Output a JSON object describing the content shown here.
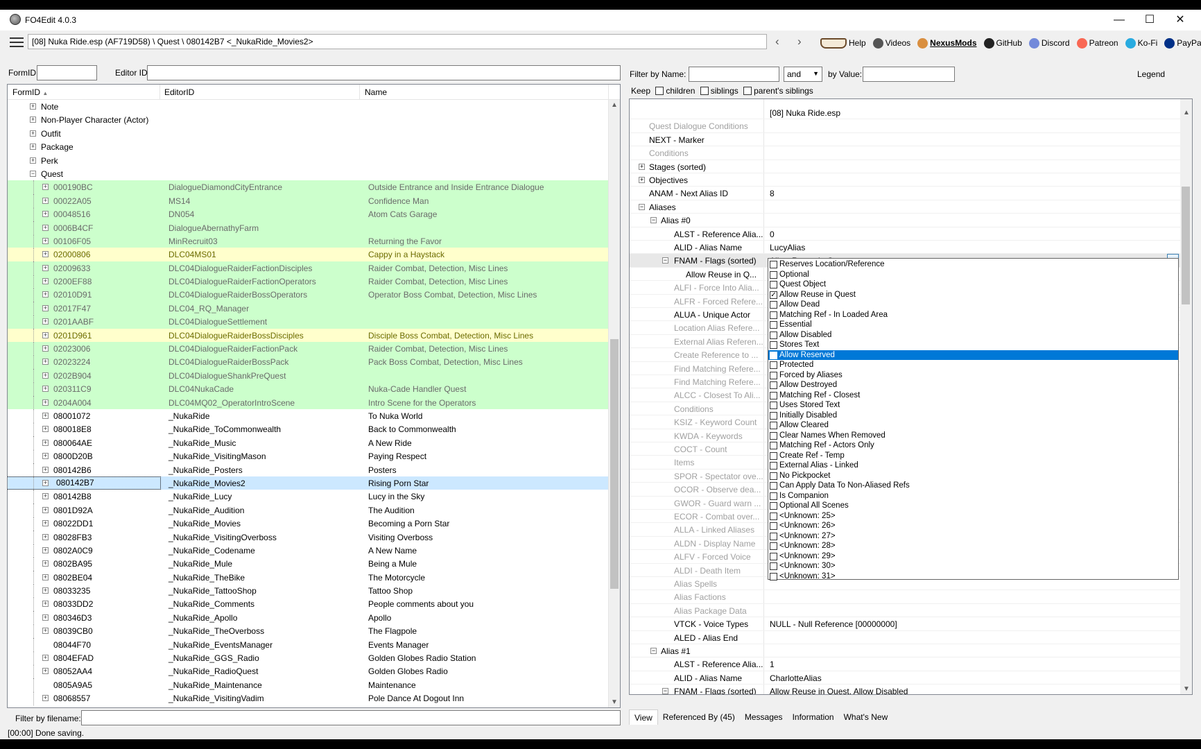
{
  "window": {
    "title": "FO4Edit 4.0.3",
    "controls": {
      "minimize": "—",
      "maximize": "☐",
      "close": "✕"
    }
  },
  "toolbar": {
    "path": "[08] Nuka Ride.esp (AF719D58) \\ Quest \\ 080142B7 <_NukaRide_Movies2>",
    "back": "‹",
    "forward": "›",
    "links": [
      {
        "label": "Help",
        "icon": "book-icon"
      },
      {
        "label": "Videos",
        "icon": "video-icon"
      },
      {
        "label": "NexusMods",
        "icon": "nexus-icon"
      },
      {
        "label": "GitHub",
        "icon": "github-icon"
      },
      {
        "label": "Discord",
        "icon": "discord-icon"
      },
      {
        "label": "Patreon",
        "icon": "patreon-icon"
      },
      {
        "label": "Ko-Fi",
        "icon": "kofi-icon"
      },
      {
        "label": "PayPal",
        "icon": "paypal-icon"
      }
    ]
  },
  "left": {
    "formid_label": "FormID",
    "editorid_label": "Editor ID",
    "formid_value": "",
    "editorid_value": "",
    "columns": {
      "formid": "FormID",
      "sort": "▲",
      "editorid": "EditorID",
      "name": "Name"
    },
    "tree": [
      {
        "id": "Note",
        "eid": "",
        "name": "",
        "type": "group"
      },
      {
        "id": "Non-Player Character (Actor)",
        "eid": "",
        "name": "",
        "type": "group"
      },
      {
        "id": "Outfit",
        "eid": "",
        "name": "",
        "type": "group"
      },
      {
        "id": "Package",
        "eid": "",
        "name": "",
        "type": "group"
      },
      {
        "id": "Perk",
        "eid": "",
        "name": "",
        "type": "group"
      },
      {
        "id": "Quest",
        "eid": "",
        "name": "",
        "type": "open"
      },
      {
        "id": "000190BC",
        "eid": "DialogueDiamondCityEntrance",
        "name": "Outside Entrance and Inside Entrance Dialogue",
        "type": "green"
      },
      {
        "id": "00022A05",
        "eid": "MS14",
        "name": "Confidence Man",
        "type": "green"
      },
      {
        "id": "00048516",
        "eid": "DN054",
        "name": "Atom Cats Garage",
        "type": "green"
      },
      {
        "id": "0006B4CF",
        "eid": "DialogueAbernathyFarm",
        "name": "",
        "type": "green"
      },
      {
        "id": "00106F05",
        "eid": "MinRecruit03",
        "name": "Returning the Favor",
        "type": "green"
      },
      {
        "id": "02000806",
        "eid": "DLC04MS01",
        "name": "Cappy in a Haystack",
        "type": "yellow"
      },
      {
        "id": "02009633",
        "eid": "DLC04DialogueRaiderFactionDisciples",
        "name": "Raider Combat, Detection, Misc Lines",
        "type": "green"
      },
      {
        "id": "0200EF88",
        "eid": "DLC04DialogueRaiderFactionOperators",
        "name": "Raider Combat, Detection, Misc Lines",
        "type": "green"
      },
      {
        "id": "02010D91",
        "eid": "DLC04DialogueRaiderBossOperators",
        "name": "Operator Boss Combat, Detection, Misc Lines",
        "type": "green"
      },
      {
        "id": "02017F47",
        "eid": "DLC04_RQ_Manager",
        "name": "",
        "type": "green"
      },
      {
        "id": "0201AABF",
        "eid": "DLC04DialogueSettlement",
        "name": "",
        "type": "green"
      },
      {
        "id": "0201D961",
        "eid": "DLC04DialogueRaiderBossDisciples",
        "name": "Disciple Boss Combat, Detection, Misc Lines",
        "type": "yellow"
      },
      {
        "id": "02023006",
        "eid": "DLC04DialogueRaiderFactionPack",
        "name": "Raider Combat, Detection, Misc Lines",
        "type": "green"
      },
      {
        "id": "02023224",
        "eid": "DLC04DialogueRaiderBossPack",
        "name": "Pack Boss Combat, Detection, Misc Lines",
        "type": "green"
      },
      {
        "id": "0202B904",
        "eid": "DLC04DialogueShankPreQuest",
        "name": "",
        "type": "green"
      },
      {
        "id": "020311C9",
        "eid": "DLC04NukaCade",
        "name": "Nuka-Cade Handler Quest",
        "type": "green"
      },
      {
        "id": "0204A004",
        "eid": "DLC04MQ02_OperatorIntroScene",
        "name": "Intro Scene for the Operators",
        "type": "green"
      },
      {
        "id": "08001072",
        "eid": "_NukaRide",
        "name": "To Nuka World",
        "type": "normal"
      },
      {
        "id": "080018E8",
        "eid": "_NukaRide_ToCommonwealth",
        "name": "Back to Commonwealth",
        "type": "normal"
      },
      {
        "id": "080064AE",
        "eid": "_NukaRide_Music",
        "name": "A New Ride",
        "type": "normal"
      },
      {
        "id": "0800D20B",
        "eid": "_NukaRide_VisitingMason",
        "name": "Paying Respect",
        "type": "normal"
      },
      {
        "id": "080142B6",
        "eid": "_NukaRide_Posters",
        "name": "Posters",
        "type": "normal"
      },
      {
        "id": "080142B7",
        "eid": "_NukaRide_Movies2",
        "name": "Rising Porn Star",
        "type": "sel"
      },
      {
        "id": "080142B8",
        "eid": "_NukaRide_Lucy",
        "name": "Lucy in the Sky",
        "type": "normal"
      },
      {
        "id": "0801D92A",
        "eid": "_NukaRide_Audition",
        "name": "The Audition",
        "type": "normal"
      },
      {
        "id": "08022DD1",
        "eid": "_NukaRide_Movies",
        "name": "Becoming a Porn Star",
        "type": "normal"
      },
      {
        "id": "08028FB3",
        "eid": "_NukaRide_VisitingOverboss",
        "name": "Visiting Overboss",
        "type": "normal"
      },
      {
        "id": "0802A0C9",
        "eid": "_NukaRide_Codename",
        "name": "A New Name",
        "type": "normal"
      },
      {
        "id": "0802BA95",
        "eid": "_NukaRide_Mule",
        "name": "Being a Mule",
        "type": "normal"
      },
      {
        "id": "0802BE04",
        "eid": "_NukaRide_TheBike",
        "name": "The Motorcycle",
        "type": "normal"
      },
      {
        "id": "08033235",
        "eid": "_NukaRide_TattooShop",
        "name": "Tattoo Shop",
        "type": "normal"
      },
      {
        "id": "08033DD2",
        "eid": "_NukaRide_Comments",
        "name": "People comments about you",
        "type": "normal"
      },
      {
        "id": "080346D3",
        "eid": "_NukaRide_Apollo",
        "name": "Apollo",
        "type": "normal"
      },
      {
        "id": "08039CB0",
        "eid": "_NukaRide_TheOverboss",
        "name": "The Flagpole",
        "type": "normal"
      },
      {
        "id": "08044F70",
        "eid": "_NukaRide_EventsManager",
        "name": "Events Manager",
        "type": "leaf"
      },
      {
        "id": "0804EFAD",
        "eid": "_NukaRide_GGS_Radio",
        "name": "Golden Globes Radio Station",
        "type": "normal"
      },
      {
        "id": "08052AA4",
        "eid": "_NukaRide_RadioQuest",
        "name": "Golden Globes Radio",
        "type": "normal"
      },
      {
        "id": "0805A9A5",
        "eid": "_NukaRide_Maintenance",
        "name": "Maintenance",
        "type": "leaf"
      },
      {
        "id": "08068557",
        "eid": "_NukaRide_VisitingVadim",
        "name": "Pole Dance At Dogout Inn",
        "type": "normal"
      }
    ],
    "filename_filter_label": "Filter by filename:",
    "filename_filter_value": ""
  },
  "right": {
    "filter_name_label": "Filter by Name:",
    "filter_name_value": "",
    "op_value": "and",
    "filter_value_label": "by Value:",
    "filter_value_value": "",
    "legend": "Legend",
    "keep_label": "Keep",
    "keep_options": [
      "children",
      "siblings",
      "parent's siblings"
    ],
    "props": [
      {
        "n": "",
        "v": "[08] Nuka Ride.esp",
        "lvl": 0,
        "exp": "",
        "dim": false
      },
      {
        "n": "Quest Dialogue Conditions",
        "v": "",
        "lvl": 0,
        "exp": "",
        "dim": true
      },
      {
        "n": "NEXT - Marker",
        "v": "",
        "lvl": 0,
        "exp": "",
        "dim": false
      },
      {
        "n": "Conditions",
        "v": "",
        "lvl": 0,
        "exp": "",
        "dim": true
      },
      {
        "n": "Stages (sorted)",
        "v": "",
        "lvl": 0,
        "exp": "+",
        "dim": false
      },
      {
        "n": "Objectives",
        "v": "",
        "lvl": 0,
        "exp": "+",
        "dim": false
      },
      {
        "n": "ANAM - Next Alias ID",
        "v": "8",
        "lvl": 0,
        "exp": "",
        "dim": false
      },
      {
        "n": "Aliases",
        "v": "",
        "lvl": 0,
        "exp": "-",
        "dim": false
      },
      {
        "n": "Alias #0",
        "v": "",
        "lvl": 1,
        "exp": "-",
        "dim": false
      },
      {
        "n": "ALST - Reference Alia...",
        "v": "0",
        "lvl": 2,
        "exp": "",
        "dim": false
      },
      {
        "n": "ALID - Alias Name",
        "v": "LucyAlias",
        "lvl": 2,
        "exp": "",
        "dim": false
      },
      {
        "n": "FNAM - Flags (sorted)",
        "v": "Allow Reuse in Quest",
        "lvl": 2,
        "exp": "-",
        "dim": false,
        "hl": true
      },
      {
        "n": "Allow Reuse in Q...",
        "v": "",
        "lvl": 3,
        "exp": "",
        "dim": false
      },
      {
        "n": "ALFI - Force Into Alia...",
        "v": "",
        "lvl": 2,
        "exp": "",
        "dim": true
      },
      {
        "n": "ALFR - Forced Refere...",
        "v": "",
        "lvl": 2,
        "exp": "",
        "dim": true
      },
      {
        "n": "ALUA - Unique Actor",
        "v": "",
        "lvl": 2,
        "exp": "",
        "dim": false
      },
      {
        "n": "Location Alias Refere...",
        "v": "",
        "lvl": 2,
        "exp": "",
        "dim": true
      },
      {
        "n": "External Alias Referen...",
        "v": "",
        "lvl": 2,
        "exp": "",
        "dim": true
      },
      {
        "n": "Create Reference to ...",
        "v": "",
        "lvl": 2,
        "exp": "",
        "dim": true
      },
      {
        "n": "Find Matching Refere...",
        "v": "",
        "lvl": 2,
        "exp": "",
        "dim": true
      },
      {
        "n": "Find Matching Refere...",
        "v": "",
        "lvl": 2,
        "exp": "",
        "dim": true
      },
      {
        "n": "ALCC - Closest To Ali...",
        "v": "",
        "lvl": 2,
        "exp": "",
        "dim": true
      },
      {
        "n": "Conditions",
        "v": "",
        "lvl": 2,
        "exp": "",
        "dim": true
      },
      {
        "n": "KSIZ - Keyword Count",
        "v": "",
        "lvl": 2,
        "exp": "",
        "dim": true
      },
      {
        "n": "KWDA - Keywords",
        "v": "",
        "lvl": 2,
        "exp": "",
        "dim": true
      },
      {
        "n": "COCT - Count",
        "v": "",
        "lvl": 2,
        "exp": "",
        "dim": true
      },
      {
        "n": "Items",
        "v": "",
        "lvl": 2,
        "exp": "",
        "dim": true
      },
      {
        "n": "SPOR - Spectator ove...",
        "v": "",
        "lvl": 2,
        "exp": "",
        "dim": true
      },
      {
        "n": "OCOR - Observe dea...",
        "v": "",
        "lvl": 2,
        "exp": "",
        "dim": true
      },
      {
        "n": "GWOR - Guard warn ...",
        "v": "",
        "lvl": 2,
        "exp": "",
        "dim": true
      },
      {
        "n": "ECOR - Combat over...",
        "v": "",
        "lvl": 2,
        "exp": "",
        "dim": true
      },
      {
        "n": "ALLA - Linked Aliases",
        "v": "",
        "lvl": 2,
        "exp": "",
        "dim": true
      },
      {
        "n": "ALDN - Display Name",
        "v": "",
        "lvl": 2,
        "exp": "",
        "dim": true
      },
      {
        "n": "ALFV - Forced Voice",
        "v": "",
        "lvl": 2,
        "exp": "",
        "dim": true
      },
      {
        "n": "ALDI - Death Item",
        "v": "",
        "lvl": 2,
        "exp": "",
        "dim": true
      },
      {
        "n": "Alias Spells",
        "v": "",
        "lvl": 2,
        "exp": "",
        "dim": true
      },
      {
        "n": "Alias Factions",
        "v": "",
        "lvl": 2,
        "exp": "",
        "dim": true
      },
      {
        "n": "Alias Package Data",
        "v": "",
        "lvl": 2,
        "exp": "",
        "dim": true
      },
      {
        "n": "VTCK - Voice Types",
        "v": "NULL - Null Reference [00000000]",
        "lvl": 2,
        "exp": "",
        "dim": false
      },
      {
        "n": "ALED - Alias End",
        "v": "",
        "lvl": 2,
        "exp": "",
        "dim": false
      },
      {
        "n": "Alias #1",
        "v": "",
        "lvl": 1,
        "exp": "-",
        "dim": false
      },
      {
        "n": "ALST - Reference Alia...",
        "v": "1",
        "lvl": 2,
        "exp": "",
        "dim": false
      },
      {
        "n": "ALID - Alias Name",
        "v": "CharlotteAlias",
        "lvl": 2,
        "exp": "",
        "dim": false
      },
      {
        "n": "FNAM - Flags (sorted)",
        "v": "Allow Reuse in Quest, Allow Disabled",
        "lvl": 2,
        "exp": "-",
        "dim": false
      }
    ],
    "flags": [
      {
        "label": "Reserves Location/Reference",
        "checked": false
      },
      {
        "label": "Optional",
        "checked": false
      },
      {
        "label": "Quest Object",
        "checked": false
      },
      {
        "label": "Allow Reuse in Quest",
        "checked": true
      },
      {
        "label": "Allow Dead",
        "checked": false
      },
      {
        "label": "Matching Ref - In Loaded Area",
        "checked": false
      },
      {
        "label": "Essential",
        "checked": false
      },
      {
        "label": "Allow Disabled",
        "checked": false
      },
      {
        "label": "Stores Text",
        "checked": false
      },
      {
        "label": "Allow Reserved",
        "checked": false,
        "selected": true
      },
      {
        "label": "Protected",
        "checked": false
      },
      {
        "label": "Forced by Aliases",
        "checked": false
      },
      {
        "label": "Allow Destroyed",
        "checked": false
      },
      {
        "label": "Matching Ref - Closest",
        "checked": false
      },
      {
        "label": "Uses Stored Text",
        "checked": false
      },
      {
        "label": "Initially Disabled",
        "checked": false
      },
      {
        "label": "Allow Cleared",
        "checked": false
      },
      {
        "label": "Clear Names When Removed",
        "checked": false
      },
      {
        "label": "Matching Ref - Actors Only",
        "checked": false
      },
      {
        "label": "Create Ref - Temp",
        "checked": false
      },
      {
        "label": "External Alias - Linked",
        "checked": false
      },
      {
        "label": "No Pickpocket",
        "checked": false
      },
      {
        "label": "Can Apply Data To Non-Aliased Refs",
        "checked": false
      },
      {
        "label": "Is Companion",
        "checked": false
      },
      {
        "label": "Optional All Scenes",
        "checked": false
      },
      {
        "label": "<Unknown: 25>",
        "checked": false
      },
      {
        "label": "<Unknown: 26>",
        "checked": false
      },
      {
        "label": "<Unknown: 27>",
        "checked": false
      },
      {
        "label": "<Unknown: 28>",
        "checked": false
      },
      {
        "label": "<Unknown: 29>",
        "checked": false
      },
      {
        "label": "<Unknown: 30>",
        "checked": false
      },
      {
        "label": "<Unknown: 31>",
        "checked": false
      }
    ],
    "tabs": [
      "View",
      "Referenced By (45)",
      "Messages",
      "Information",
      "What's New"
    ]
  },
  "status": "[00:00] Done saving."
}
